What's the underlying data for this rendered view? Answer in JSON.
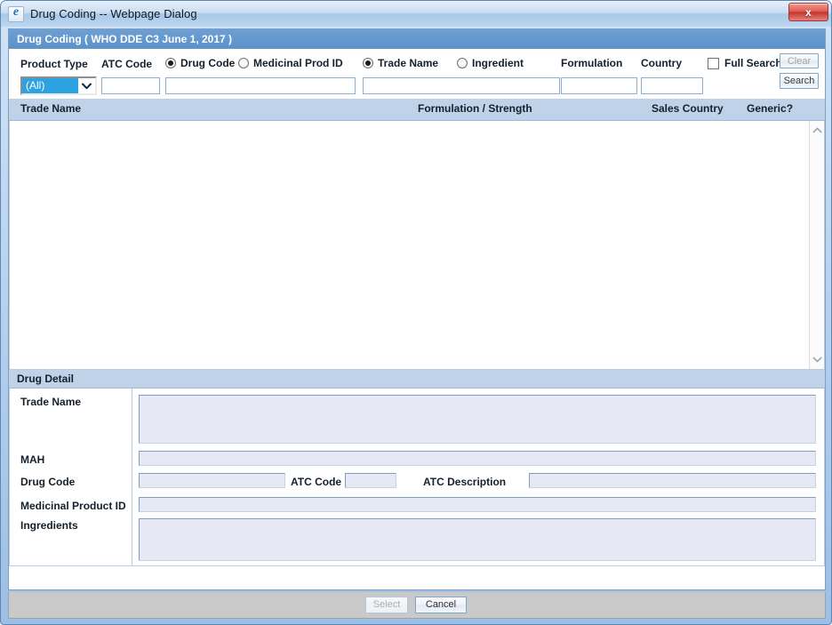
{
  "window": {
    "title": "Drug Coding -- Webpage Dialog",
    "icon": "ie-browser-icon",
    "close_label": "x"
  },
  "dialog": {
    "header": "Drug Coding ( WHO DDE C3 June 1, 2017 )"
  },
  "search": {
    "product_type": {
      "label": "Product Type",
      "selected": "(All)",
      "options": [
        "(All)"
      ]
    },
    "atc_code": {
      "label": "ATC Code",
      "value": "",
      "placeholder": ""
    },
    "code_group": {
      "options": [
        {
          "label": "Drug Code",
          "selected": true
        },
        {
          "label": "Medicinal Prod ID",
          "selected": false
        }
      ],
      "value": "",
      "placeholder": ""
    },
    "name_group": {
      "options": [
        {
          "label": "Trade Name",
          "selected": true
        },
        {
          "label": "Ingredient",
          "selected": false
        }
      ],
      "value": "",
      "placeholder": ""
    },
    "formulation": {
      "label": "Formulation",
      "value": "",
      "placeholder": ""
    },
    "country": {
      "label": "Country",
      "value": "",
      "placeholder": ""
    },
    "full_search": {
      "label": "Full Search",
      "checked": false
    },
    "clear_button": "Clear",
    "search_button": "Search"
  },
  "results": {
    "columns": [
      {
        "label": "Trade Name"
      },
      {
        "label": "Formulation / Strength"
      },
      {
        "label": "Sales Country"
      },
      {
        "label": "Generic?"
      }
    ],
    "rows": []
  },
  "detail": {
    "header": "Drug Detail",
    "trade_name": {
      "label": "Trade Name",
      "value": ""
    },
    "mah": {
      "label": "MAH",
      "value": ""
    },
    "drug_code": {
      "label": "Drug Code",
      "value": ""
    },
    "atc_code": {
      "label": "ATC Code",
      "value": ""
    },
    "atc_description": {
      "label": "ATC Description",
      "value": ""
    },
    "medicinal_product_id": {
      "label": "Medicinal Product ID",
      "value": ""
    },
    "ingredients": {
      "label": "Ingredients",
      "value": ""
    }
  },
  "footer": {
    "select_button": "Select",
    "cancel_button": "Cancel"
  },
  "colors": {
    "accent": "#5b92cc",
    "grid_header": "#bfd2e8",
    "field_bg": "#e6e8f4",
    "select_highlight": "#2ca2e0"
  }
}
